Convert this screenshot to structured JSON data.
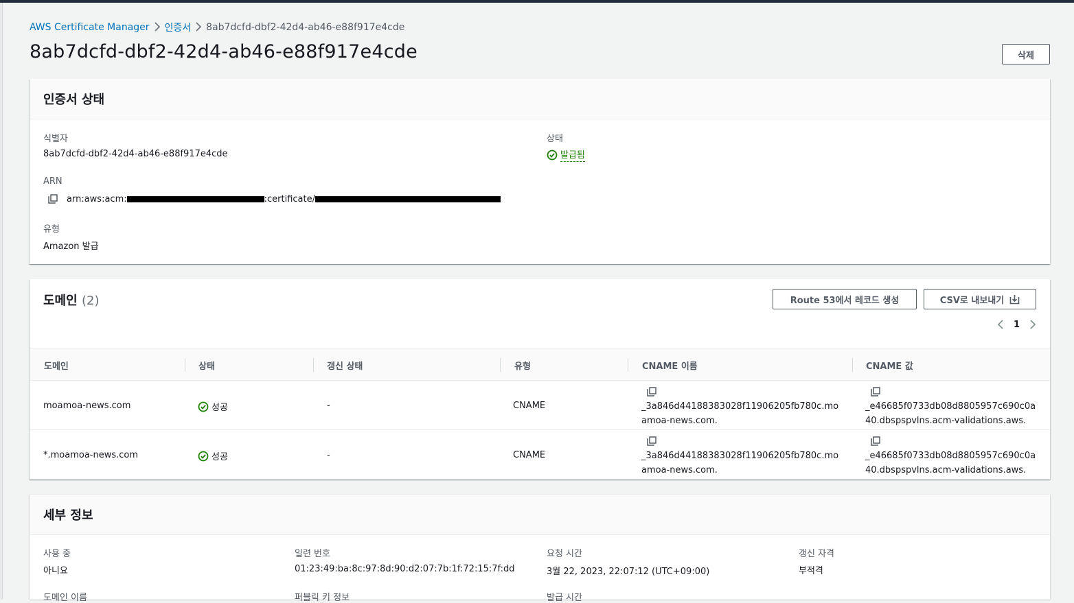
{
  "breadcrumb": {
    "root": "AWS Certificate Manager",
    "section": "인증서",
    "current": "8ab7dcfd-dbf2-42d4-ab46-e88f917e4cde"
  },
  "page": {
    "title": "8ab7dcfd-dbf2-42d4-ab46-e88f917e4cde",
    "delete_label": "삭제"
  },
  "status_panel": {
    "title": "인증서 상태",
    "identifier_label": "식별자",
    "identifier_value": "8ab7dcfd-dbf2-42d4-ab46-e88f917e4cde",
    "status_label": "상태",
    "status_value": "발급됨",
    "arn_label": "ARN",
    "arn_prefix": "arn:aws:acm:",
    "arn_mid": ":certificate/",
    "type_label": "유형",
    "type_value": "Amazon 발급"
  },
  "domains_panel": {
    "title": "도메인",
    "count": "(2)",
    "route53_label": "Route 53에서 레코드 생성",
    "csv_label": "CSV로 내보내기",
    "page_number": "1",
    "columns": {
      "domain": "도메인",
      "status": "상태",
      "renewal": "갱신 상태",
      "type": "유형",
      "cname_name": "CNAME 이름",
      "cname_value": "CNAME 값"
    },
    "rows": [
      {
        "domain": "moamoa-news.com",
        "status": "성공",
        "renewal": "-",
        "type": "CNAME",
        "cname_name": "_3a846d44188383028f11906205fb780c.moamoa-news.com.",
        "cname_value": "_e46685f0733db08d8805957c690c0a40.dbspspvlns.acm-validations.aws."
      },
      {
        "domain": "*.moamoa-news.com",
        "status": "성공",
        "renewal": "-",
        "type": "CNAME",
        "cname_name": "_3a846d44188383028f11906205fb780c.moamoa-news.com.",
        "cname_value": "_e46685f0733db08d8805957c690c0a40.dbspspvlns.acm-validations.aws."
      }
    ]
  },
  "details_panel": {
    "title": "세부 정보",
    "in_use_label": "사용 중",
    "in_use_value": "아니요",
    "serial_label": "일련 번호",
    "serial_value": "01:23:49:ba:8c:97:8d:90:d2:07:7b:1f:72:15:7f:dd",
    "requested_label": "요청 시간",
    "requested_value": "3월 22, 2023, 22:07:12 (UTC+09:00)",
    "renewal_label": "갱신 자격",
    "renewal_value": "부적격",
    "domain_name_label": "도메인 이름",
    "public_key_label": "퍼블릭 키 정보",
    "issued_label": "발급 시간"
  },
  "colors": {
    "link": "#0073bb",
    "success": "#1d8102",
    "top_bar": "#232f3e"
  },
  "icons": [
    "chevron-right-icon",
    "copy-icon",
    "status-success-icon",
    "export-icon",
    "chevron-left-icon"
  ]
}
